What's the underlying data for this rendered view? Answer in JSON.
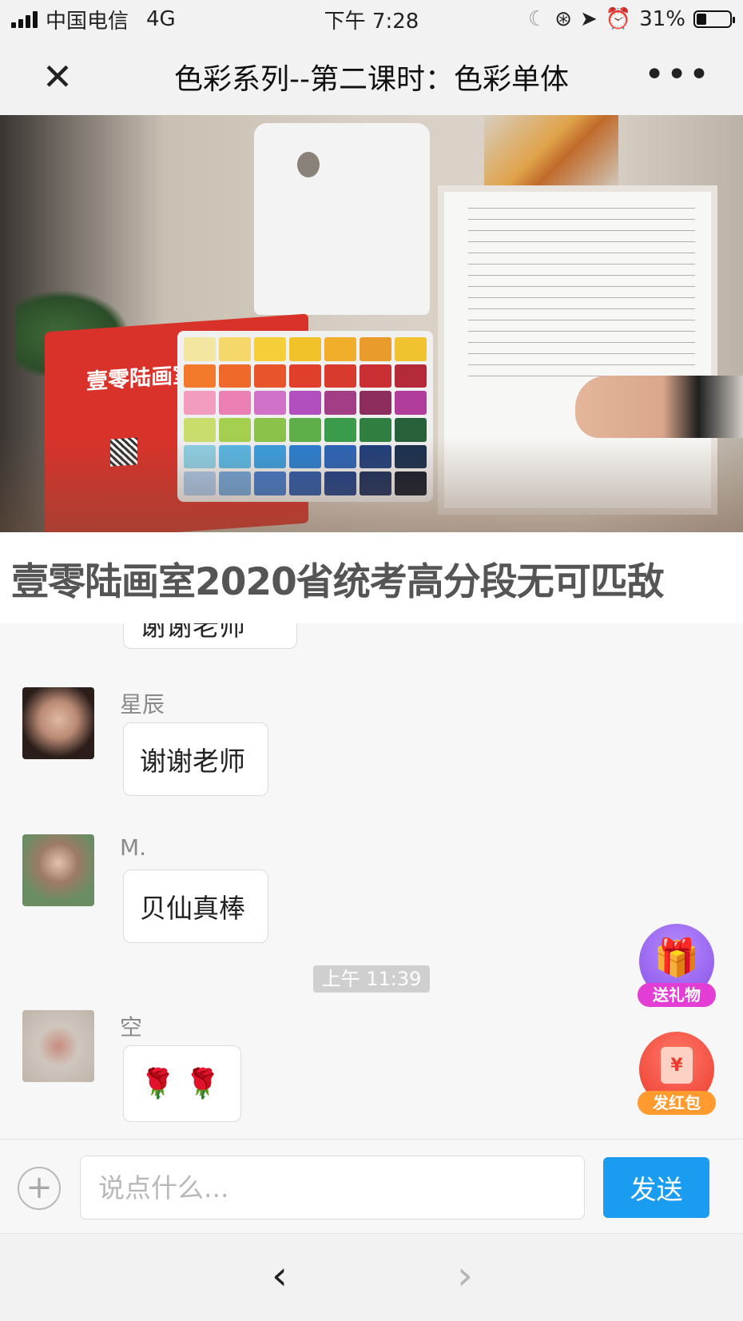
{
  "status_bar": {
    "carrier": "中国电信",
    "network": "4G",
    "time": "下午 7:28",
    "battery_text": "31%",
    "battery_level": 0.31,
    "icons": [
      "moon-icon",
      "lock-rotation-icon",
      "location-icon",
      "alarm-icon"
    ]
  },
  "nav": {
    "close_icon": "close-icon",
    "title": "色彩系列--第二课时：色彩单体",
    "more_icon": "more-icon"
  },
  "video": {
    "bag_logo": "壹零陆画室"
  },
  "banner": {
    "text": "壹零陆画室2020省统考高分段无可匹敌"
  },
  "chat": {
    "cut_message": "谢谢老师",
    "messages": [
      {
        "name": "星辰",
        "text": "谢谢老师"
      },
      {
        "name": "M.",
        "text": "贝仙真棒"
      },
      {
        "name": "空",
        "text": "🌹 🌹"
      }
    ],
    "timestamp": "上午 11:39"
  },
  "fabs": {
    "gift_label": "送礼物",
    "redpacket_label": "发红包",
    "redpacket_symbol": "¥"
  },
  "input": {
    "placeholder": "说点什么...",
    "value": "",
    "send_label": "发送",
    "plus_symbol": "+"
  },
  "toolbar": {
    "back_symbol": "‹",
    "forward_symbol": "›"
  },
  "colors": {
    "accent_blue": "#1a9cf0",
    "gift_purple": "#9b5cf6",
    "redpacket_red": "#f04a3a"
  }
}
